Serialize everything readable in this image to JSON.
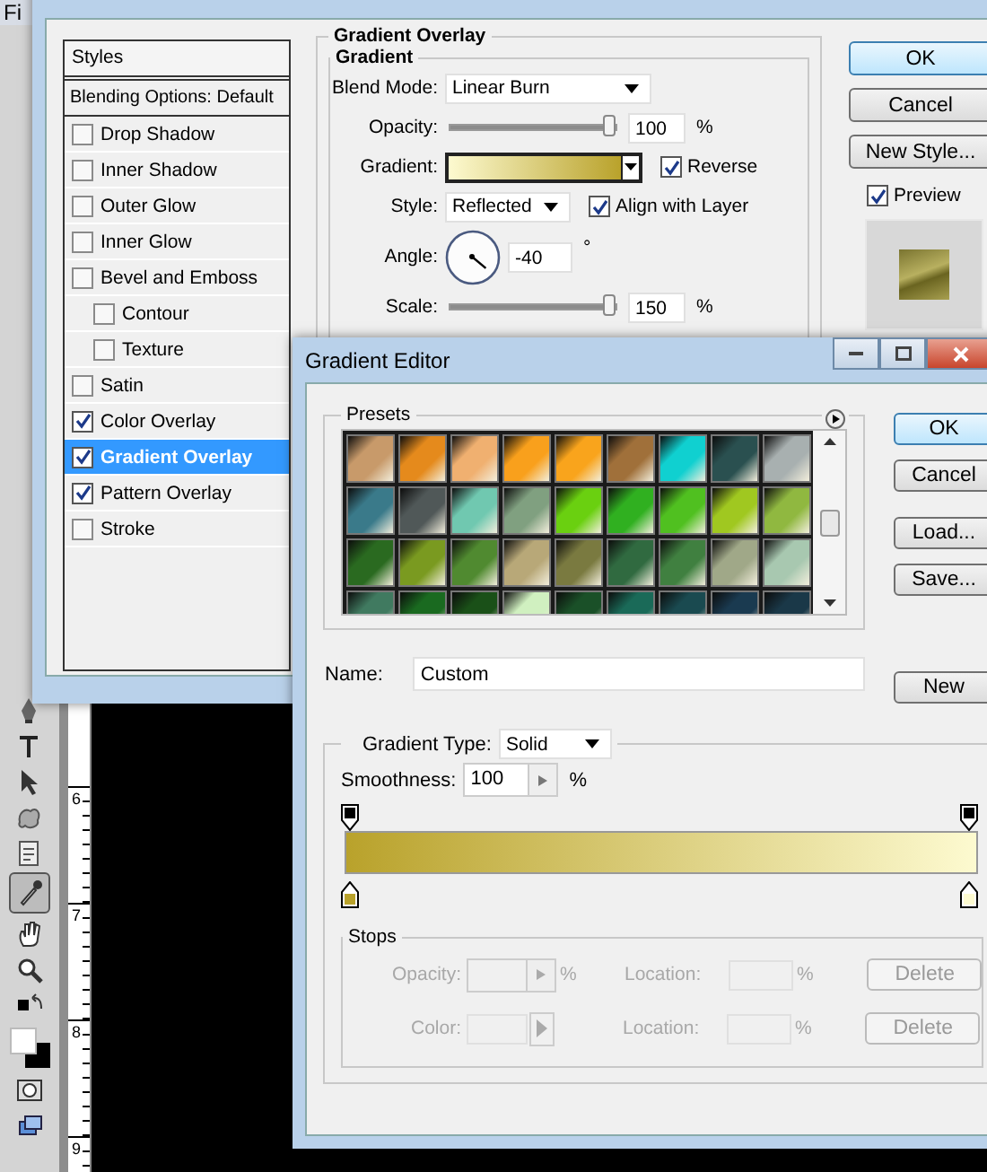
{
  "app": {
    "menu_text": "Fi",
    "ruler_labels": [
      "6",
      "7",
      "8",
      "9"
    ],
    "tools": [
      {
        "kind": "pen",
        "selected": false
      },
      {
        "kind": "type",
        "selected": false
      },
      {
        "kind": "arrow",
        "selected": false
      },
      {
        "kind": "shape",
        "selected": false
      },
      {
        "kind": "notes",
        "selected": false
      },
      {
        "kind": "eyedropper",
        "selected": true
      },
      {
        "kind": "hand",
        "selected": false
      },
      {
        "kind": "zoom",
        "selected": false
      },
      {
        "kind": "default-colors",
        "selected": false
      },
      {
        "kind": "colors",
        "selected": false
      },
      {
        "kind": "mask",
        "selected": false
      },
      {
        "kind": "screen",
        "selected": false
      }
    ]
  },
  "layer_style": {
    "styles_header": "Styles",
    "blending_options": "Blending Options: Default",
    "styles": [
      {
        "label": "Drop Shadow",
        "checked": false,
        "selected": false
      },
      {
        "label": "Inner Shadow",
        "checked": false,
        "selected": false
      },
      {
        "label": "Outer Glow",
        "checked": false,
        "selected": false
      },
      {
        "label": "Inner Glow",
        "checked": false,
        "selected": false
      },
      {
        "label": "Bevel and Emboss",
        "checked": false,
        "selected": false,
        "children": [
          {
            "label": "Contour",
            "checked": false,
            "selected": false
          },
          {
            "label": "Texture",
            "checked": false,
            "selected": false
          }
        ]
      },
      {
        "label": "Satin",
        "checked": false,
        "selected": false
      },
      {
        "label": "Color Overlay",
        "checked": true,
        "selected": false
      },
      {
        "label": "Gradient Overlay",
        "checked": true,
        "selected": true
      },
      {
        "label": "Pattern Overlay",
        "checked": true,
        "selected": false
      },
      {
        "label": "Stroke",
        "checked": false,
        "selected": false
      }
    ],
    "group_title": "Gradient Overlay",
    "subgroup_title": "Gradient",
    "blend_mode": {
      "label": "Blend Mode:",
      "value": "Linear Burn"
    },
    "opacity": {
      "label": "Opacity:",
      "level": 0.97,
      "value": "100",
      "unit": "%"
    },
    "gradient": {
      "label": "Gradient:"
    },
    "reverse": {
      "label": "Reverse",
      "checked": true
    },
    "style": {
      "label": "Style:",
      "value": "Reflected"
    },
    "align_with_layer": {
      "label": "Align with Layer",
      "checked": true
    },
    "angle": {
      "label": "Angle:",
      "value": "-40",
      "unit": "°"
    },
    "scale": {
      "label": "Scale:",
      "level": 0.97,
      "value": "150",
      "unit": "%"
    },
    "buttons": [
      {
        "label": "OK",
        "default": true
      },
      {
        "label": "Cancel",
        "default": false
      },
      {
        "label": "New Style...",
        "default": false
      }
    ],
    "preview": {
      "label": "Preview",
      "checked": true
    }
  },
  "gradient_editor": {
    "title": "Gradient Editor",
    "presets_label": "Presets",
    "presets": [
      {
        "color": "#c89a6a"
      },
      {
        "color": "#e58a1c"
      },
      {
        "color": "#f0b070"
      },
      {
        "color": "#f9a01c"
      },
      {
        "color": "#f9a41c"
      },
      {
        "color": "#a0703a"
      },
      {
        "color": "#10d0d0"
      },
      {
        "color": "#2a5050"
      },
      {
        "color": "#a8b0b0"
      },
      {
        "color": "#3a7a8a"
      },
      {
        "color": "#505858"
      },
      {
        "color": "#70c8b0"
      },
      {
        "color": "#80a080"
      },
      {
        "color": "#6ad010"
      },
      {
        "color": "#30b020"
      },
      {
        "color": "#50c020"
      },
      {
        "color": "#a0c820"
      },
      {
        "color": "#90b840"
      },
      {
        "color": "#2a6a20"
      },
      {
        "color": "#7a9a20"
      },
      {
        "color": "#508a30"
      },
      {
        "color": "#b8a878"
      },
      {
        "color": "#7a7a40"
      },
      {
        "color": "#306a40"
      },
      {
        "color": "#408040"
      },
      {
        "color": "#a0a888"
      },
      {
        "color": "#a8c8b0"
      },
      {
        "color": "#407a60"
      },
      {
        "color": "#1a6a20"
      },
      {
        "color": "#1a5018"
      },
      {
        "color": "#d0f0c0"
      },
      {
        "color": "#1a5028"
      },
      {
        "color": "#1a6a58"
      },
      {
        "color": "#1a4a50"
      },
      {
        "color": "#1a3a50"
      },
      {
        "color": "#1a3848"
      }
    ],
    "buttons": [
      {
        "label": "OK",
        "default": true
      },
      {
        "label": "Cancel",
        "default": false
      },
      {
        "label": "Load...",
        "default": false
      },
      {
        "label": "Save...",
        "default": false
      }
    ],
    "name": {
      "label": "Name:",
      "value": "Custom"
    },
    "new_button": "New",
    "gradient_type": {
      "label": "Gradient Type:",
      "value": "Solid"
    },
    "smoothness": {
      "label": "Smoothness:",
      "value": "100",
      "unit": "%"
    },
    "color_stops": [
      {
        "color": "#b9a22b"
      },
      {
        "color": "#fdfad0"
      }
    ],
    "stops": {
      "title": "Stops",
      "disabled": true,
      "rows": [
        {
          "kind": "stepper",
          "label": "Opacity:",
          "unit": "%",
          "location_label": "Location:",
          "location_unit": "%",
          "delete": "Delete"
        },
        {
          "kind": "color",
          "label": "Color:",
          "unit": "",
          "location_label": "Location:",
          "location_unit": "%",
          "delete": "Delete"
        }
      ]
    }
  }
}
